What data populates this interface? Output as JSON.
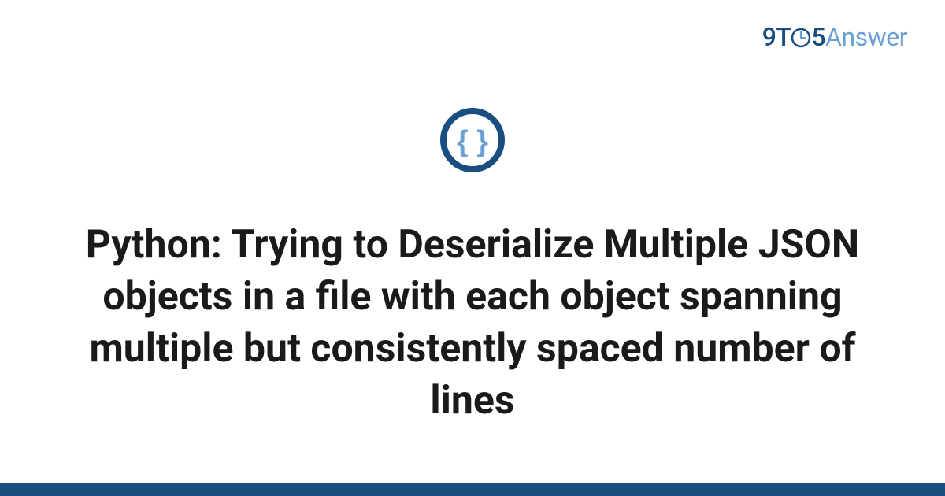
{
  "logo": {
    "nine": "9",
    "t": "T",
    "five": "5",
    "answer": "Answer"
  },
  "icon": {
    "name": "braces-icon",
    "ring_color": "#1a4d80",
    "glyph_color": "#6a9fd4"
  },
  "title": "Python: Trying to Deserialize Multiple JSON objects in a file with each object spanning multiple but consistently spaced number of lines",
  "colors": {
    "brand_dark": "#1a4d80",
    "brand_light": "#6a9fd4",
    "text": "#1a1a1a",
    "background": "#ffffff"
  }
}
